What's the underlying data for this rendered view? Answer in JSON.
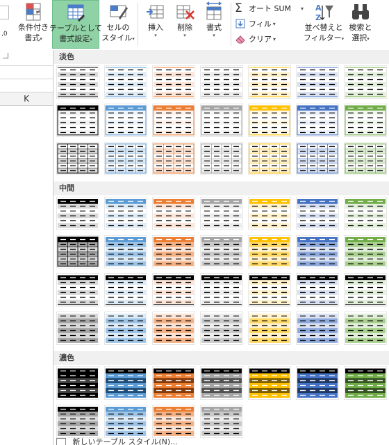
{
  "ribbon": {
    "conditional": {
      "line1": "条件付き",
      "line2": "書式"
    },
    "format_table": {
      "line1": "テーブルとして",
      "line2": "書式設定"
    },
    "cell_style": {
      "line1": "セルの",
      "line2": "スタイル"
    },
    "insert": {
      "label": "挿入"
    },
    "delete": {
      "label": "削除"
    },
    "format": {
      "label": "書式"
    },
    "autosum": {
      "label": "オート SUM"
    },
    "fill": {
      "label": "フィル"
    },
    "clear": {
      "label": "クリア"
    },
    "sort_filter": {
      "line1": "並べ替えと",
      "line2": "フィルター"
    },
    "find_select": {
      "line1": "検索と",
      "line2": "選択"
    },
    "dropdown_arrow": "▾"
  },
  "sheet": {
    "column_header": "K"
  },
  "gallery": {
    "sections": [
      {
        "title": "淡色",
        "rows": [
          [
            "light-plain",
            "light-plain",
            "light-plain",
            "light-plain",
            "light-plain",
            "light-plain",
            "light-plain"
          ],
          [
            "light-header",
            "light-header",
            "light-header",
            "light-header",
            "light-header",
            "light-header",
            "light-header"
          ],
          [
            "light-grid",
            "light-grid",
            "light-grid",
            "light-grid",
            "light-grid",
            "light-grid",
            "light-grid"
          ]
        ]
      },
      {
        "title": "中間",
        "rows": [
          [
            "medium-header",
            "medium-header",
            "medium-header",
            "medium-header",
            "medium-header",
            "medium-header",
            "medium-header"
          ],
          [
            "medium-grid",
            "medium-banded",
            "medium-banded",
            "medium-banded",
            "medium-banded",
            "medium-banded",
            "medium-banded"
          ],
          [
            "medium-dark-header",
            "medium-dark-header",
            "medium-dark-header",
            "medium-dark-header",
            "medium-dark-header",
            "medium-dark-header",
            "medium-dark-header"
          ],
          [
            "medium-full",
            "medium-full",
            "medium-full",
            "medium-full",
            "medium-full",
            "medium-full",
            "medium-full"
          ]
        ]
      },
      {
        "title": "濃色",
        "rows": [
          [
            "dark",
            "dark",
            "dark",
            "dark",
            "dark",
            "dark",
            "dark"
          ],
          [
            "dark-light",
            "dark-light",
            "dark-light",
            "dark-light"
          ]
        ]
      }
    ],
    "colors": [
      {
        "name": "black",
        "main": "#000000",
        "medium": "#a6a6a6",
        "light": "#d9d9d9",
        "pale": "#f2f2f2",
        "dark": "#404040"
      },
      {
        "name": "blue",
        "main": "#5b9bd5",
        "medium": "#9dc3e6",
        "light": "#ddebf7",
        "pale": "#eef5fb",
        "dark": "#1f4e79"
      },
      {
        "name": "orange",
        "main": "#ed7d31",
        "medium": "#f4b183",
        "light": "#fce4d6",
        "pale": "#fef2ea",
        "dark": "#843c0c"
      },
      {
        "name": "gray",
        "main": "#a5a5a5",
        "medium": "#c9c9c9",
        "light": "#ededed",
        "pale": "#f6f6f6",
        "dark": "#525252"
      },
      {
        "name": "gold",
        "main": "#ffc000",
        "medium": "#ffd966",
        "light": "#fff2cc",
        "pale": "#fff9e5",
        "dark": "#7f6000"
      },
      {
        "name": "navy",
        "main": "#4472c4",
        "medium": "#8ea9db",
        "light": "#d9e1f2",
        "pale": "#ecf0f9",
        "dark": "#203864"
      },
      {
        "name": "green",
        "main": "#70ad47",
        "medium": "#a9d08e",
        "light": "#e2efda",
        "pale": "#f0f7ec",
        "dark": "#375623"
      }
    ],
    "new_table_style": "新しいテーブル スタイル(N)..."
  }
}
